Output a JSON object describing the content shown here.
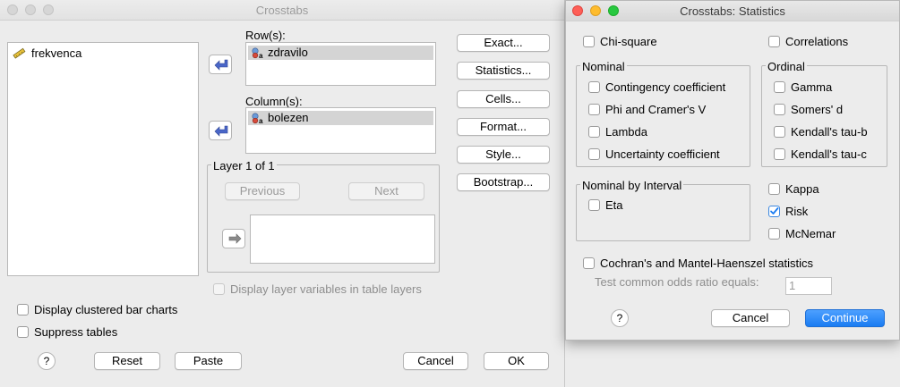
{
  "main_window": {
    "title": "Crosstabs",
    "variables": [
      "frekvenca"
    ],
    "rows_label": "Row(s):",
    "rows_items": [
      "zdravilo"
    ],
    "columns_label": "Column(s):",
    "columns_items": [
      "bolezen"
    ],
    "layer_label": "Layer 1 of 1",
    "previous_label": "Previous",
    "next_label": "Next",
    "display_layer_label": "Display layer variables in table layers",
    "buttons": {
      "exact": "Exact...",
      "statistics": "Statistics...",
      "cells": "Cells...",
      "format": "Format...",
      "style": "Style...",
      "bootstrap": "Bootstrap..."
    },
    "display_clustered_label": "Display clustered bar charts",
    "suppress_tables_label": "Suppress tables",
    "help": "?",
    "reset": "Reset",
    "paste": "Paste",
    "cancel": "Cancel",
    "ok": "OK"
  },
  "stats_window": {
    "title": "Crosstabs: Statistics",
    "chi_square": "Chi-square",
    "correlations": "Correlations",
    "nominal_label": "Nominal",
    "nominal_items": [
      "Contingency coefficient",
      "Phi and Cramer's V",
      "Lambda",
      "Uncertainty coefficient"
    ],
    "ordinal_label": "Ordinal",
    "ordinal_items": [
      "Gamma",
      "Somers' d",
      "Kendall's tau-b",
      "Kendall's tau-c"
    ],
    "nominal_interval_label": "Nominal by Interval",
    "eta": "Eta",
    "kappa": "Kappa",
    "risk": "Risk",
    "mcnemar": "McNemar",
    "cochran": "Cochran's and Mantel-Haenszel statistics",
    "test_odds_label": "Test common odds ratio equals:",
    "test_odds_value": "1",
    "help": "?",
    "cancel": "Cancel",
    "continue": "Continue",
    "risk_checked": true
  },
  "colors": {
    "accent": "#1a7cf2",
    "traffic_red": "#fe5f57",
    "traffic_yellow": "#febc2e",
    "traffic_green": "#28c840"
  },
  "icons": [
    "ruler-scale-icon",
    "nominal-variable-icon",
    "arrow-left-icon",
    "arrow-right-icon",
    "checkmark-icon"
  ]
}
